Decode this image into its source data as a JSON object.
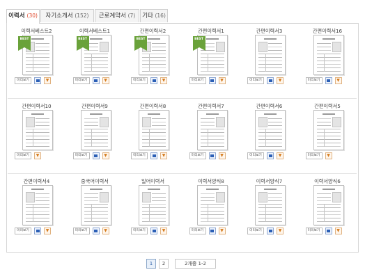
{
  "tabs": [
    {
      "label": "이력서",
      "count": "(30)"
    },
    {
      "label": "자기소개서",
      "count": "(152)"
    },
    {
      "label": "근로계약서",
      "count": "(7)"
    },
    {
      "label": "기타",
      "count": "(16)"
    }
  ],
  "action_label": "미리보기",
  "badge_label": "BEST",
  "items": [
    {
      "title": "이력서베스트2",
      "best": true,
      "word": true
    },
    {
      "title": "이력서베스트1",
      "best": true,
      "word": true
    },
    {
      "title": "간편이력서2",
      "best": true,
      "word": true
    },
    {
      "title": "간편이력서1",
      "best": true,
      "word": true
    },
    {
      "title": "간편이력서3",
      "best": false,
      "word": true
    },
    {
      "title": "간편이력서16",
      "best": false,
      "word": true
    },
    {
      "title": "간편이력서10",
      "best": false,
      "word": false
    },
    {
      "title": "간편이력서9",
      "best": false,
      "word": true
    },
    {
      "title": "간편이력서8",
      "best": false,
      "word": true
    },
    {
      "title": "간편이력서7",
      "best": false,
      "word": true
    },
    {
      "title": "간편이력서6",
      "best": false,
      "word": true
    },
    {
      "title": "간편이력서5",
      "best": false,
      "word": false
    },
    {
      "title": "간편이력서4",
      "best": false,
      "word": true
    },
    {
      "title": "중국어이력서",
      "best": false,
      "word": true
    },
    {
      "title": "일어이력서",
      "best": false,
      "word": true
    },
    {
      "title": "이력서양식8",
      "best": false,
      "word": true
    },
    {
      "title": "이력서양식7",
      "best": false,
      "word": true
    },
    {
      "title": "이력서양식6",
      "best": false,
      "word": true
    }
  ],
  "pager": {
    "page1": "1",
    "page2": "2",
    "range": "2개중 1-2"
  }
}
